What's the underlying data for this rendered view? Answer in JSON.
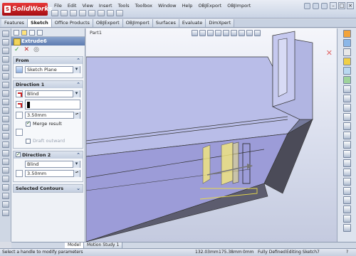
{
  "app": {
    "logo_text": "SolidWorks",
    "menu": [
      "File",
      "Edit",
      "View",
      "Insert",
      "Tools",
      "Toolbox",
      "Window",
      "Help",
      "OBJExport",
      "OBJImport"
    ]
  },
  "command_tabs": [
    "Features",
    "Sketch",
    "Office Products",
    "OBJExport",
    "OBJImport",
    "Surfaces",
    "Evaluate",
    "DimXpert"
  ],
  "active_tab": "Sketch",
  "property_manager": {
    "feature_title": "Extrude6",
    "from": {
      "title": "From",
      "value": "Sketch Plane"
    },
    "direction1": {
      "title": "Direction 1",
      "end_condition": "Blind",
      "depth": "3.50mm",
      "merge_result_label": "Merge result",
      "merge_result_checked": true,
      "draft_outward_label": "Draft outward",
      "draft_outward_enabled": false
    },
    "direction2": {
      "title": "Direction 2",
      "checked": true,
      "end_condition": "Blind",
      "depth": "3.50mm"
    },
    "selected_contours": {
      "title": "Selected Contours"
    }
  },
  "viewport": {
    "document_name": "Part1",
    "model_color": "#9c9cd8",
    "highlight_color": "#f5e97a"
  },
  "bottom_tabs": [
    "Model",
    "Motion Study 1"
  ],
  "status_bar": {
    "message": "Select a handle to modify parameters",
    "x": "132.03mm",
    "y": "175.38mm",
    "z": "0mm",
    "state": "Fully Defined",
    "mode": "Editing Sketch7"
  }
}
